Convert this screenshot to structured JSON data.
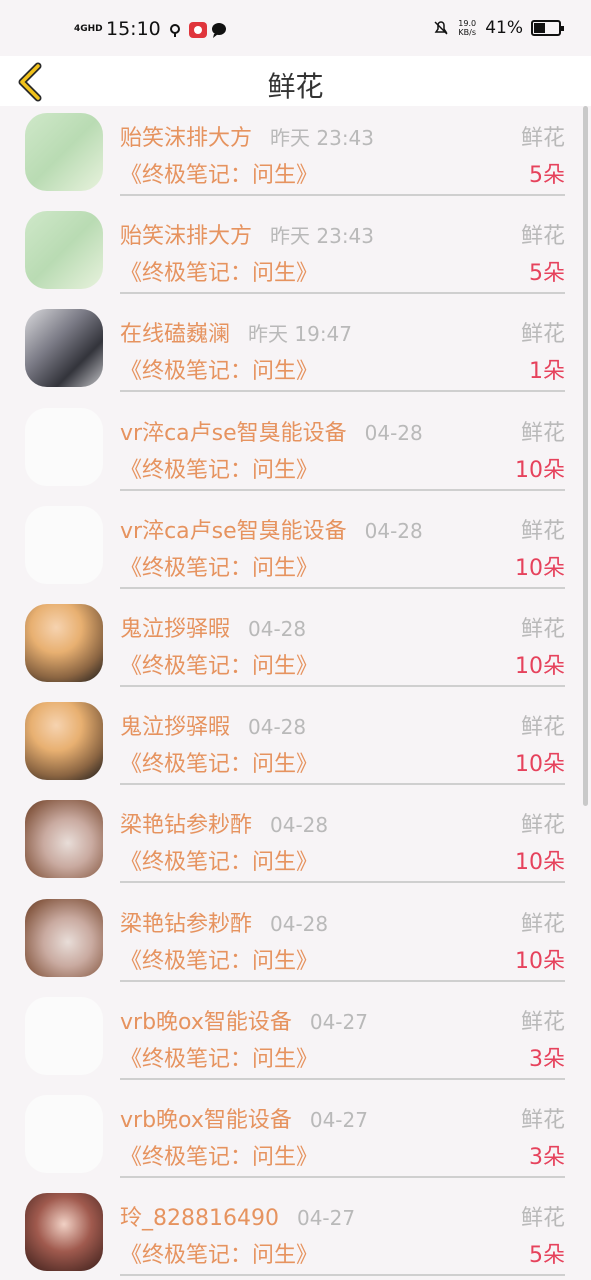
{
  "status_bar": {
    "network": "4GHD",
    "time": "15:10",
    "speed_value": "19.0",
    "speed_unit": "KB/s",
    "battery": "41%",
    "battery_level": 0.41
  },
  "nav": {
    "title": "鲜花"
  },
  "rows": [
    {
      "avatar": "frog",
      "name": "贻笑沫排大方",
      "time": "昨天 23:43",
      "book": "《终极笔记：问生》",
      "gift": "鲜花",
      "count": "5朵"
    },
    {
      "avatar": "frog",
      "name": "贻笑沫排大方",
      "time": "昨天 23:43",
      "book": "《终极笔记：问生》",
      "gift": "鲜花",
      "count": "5朵"
    },
    {
      "avatar": "art",
      "name": "在线磕巍澜",
      "time": "昨天 19:47",
      "book": "《终极笔记：问生》",
      "gift": "鲜花",
      "count": "1朵"
    },
    {
      "avatar": "text",
      "name": "vr淬ca卢se智臭能设备",
      "time": "04-28",
      "book": "《终极笔记：问生》",
      "gift": "鲜花",
      "count": "10朵"
    },
    {
      "avatar": "text",
      "name": "vr淬ca卢se智臭能设备",
      "time": "04-28",
      "book": "《终极笔记：问生》",
      "gift": "鲜花",
      "count": "10朵"
    },
    {
      "avatar": "girl",
      "name": "鬼泣拶驿暇",
      "time": "04-28",
      "book": "《终极笔记：问生》",
      "gift": "鲜花",
      "count": "10朵"
    },
    {
      "avatar": "girl",
      "name": "鬼泣拶驿暇",
      "time": "04-28",
      "book": "《终极笔记：问生》",
      "gift": "鲜花",
      "count": "10朵"
    },
    {
      "avatar": "cat",
      "name": "梁艳钻参耖酢",
      "time": "04-28",
      "book": "《终极笔记：问生》",
      "gift": "鲜花",
      "count": "10朵"
    },
    {
      "avatar": "cat",
      "name": "梁艳钻参耖酢",
      "time": "04-28",
      "book": "《终极笔记：问生》",
      "gift": "鲜花",
      "count": "10朵"
    },
    {
      "avatar": "text",
      "name": "vrb晚ox智能设备",
      "time": "04-27",
      "book": "《终极笔记：问生》",
      "gift": "鲜花",
      "count": "3朵"
    },
    {
      "avatar": "text",
      "name": "vrb晚ox智能设备",
      "time": "04-27",
      "book": "《终极笔记：问生》",
      "gift": "鲜花",
      "count": "3朵"
    },
    {
      "avatar": "qipao",
      "name": "玲_828816490",
      "time": "04-27",
      "book": "《终极笔记：问生》",
      "gift": "鲜花",
      "count": "5朵"
    }
  ],
  "colors": {
    "accent": "#e6935f",
    "count": "#e6425c",
    "muted": "#b9b9b9",
    "back_icon": "#f2c21b"
  }
}
